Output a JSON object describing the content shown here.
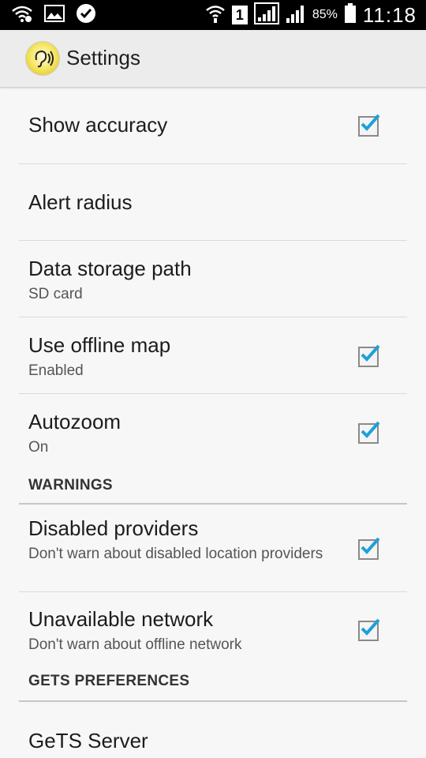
{
  "status_bar": {
    "battery_percent": "85%",
    "sim_slot": "1",
    "time": "11:18",
    "icons": [
      "wifi-icon",
      "image-icon",
      "check-circle-icon",
      "wifi-signal-icon",
      "sim-icon",
      "signal-icon",
      "signal-icon",
      "battery-icon"
    ]
  },
  "action_bar": {
    "title": "Settings",
    "app_icon": "hearing-app-icon"
  },
  "preferences": {
    "show_accuracy": {
      "title": "Show accuracy",
      "checked": true
    },
    "alert_radius": {
      "title": "Alert radius"
    },
    "data_storage_path": {
      "title": "Data storage path",
      "summary": "SD card"
    },
    "use_offline_map": {
      "title": "Use offline map",
      "summary": "Enabled",
      "checked": true
    },
    "autozoom": {
      "title": "Autozoom",
      "summary": "On",
      "checked": true
    }
  },
  "warnings_section": {
    "header": "WARNINGS",
    "disabled_providers": {
      "title": "Disabled providers",
      "summary": "Don't warn about disabled location providers",
      "checked": true
    },
    "unavailable_network": {
      "title": "Unavailable network",
      "summary": "Don't warn about offline network",
      "checked": true
    }
  },
  "gets_section": {
    "header": "GETS PREFERENCES",
    "gets_server": {
      "title": "GeTS Server"
    }
  },
  "colors": {
    "accent_check": "#1ea0d8",
    "background": "#f7f7f7"
  }
}
